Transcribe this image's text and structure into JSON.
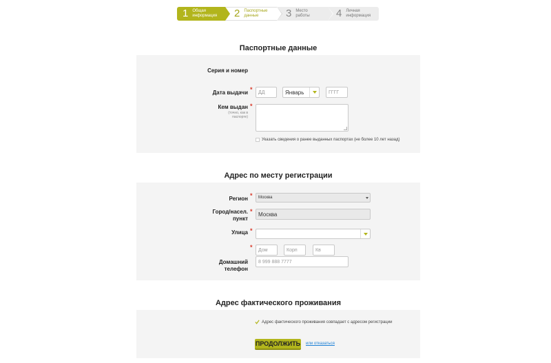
{
  "stepper": {
    "steps": [
      {
        "num": "1",
        "label": "Общая информация"
      },
      {
        "num": "2",
        "label": "Паспортные данные"
      },
      {
        "num": "3",
        "label": "Место работы"
      },
      {
        "num": "4",
        "label": "Личная информация"
      }
    ]
  },
  "passport": {
    "title": "Паспортные данные",
    "series_label": "Серия и номер",
    "issue_date_label": "Дата выдачи",
    "day_placeholder": "ДД",
    "month_value": "Январь",
    "year_placeholder": "ГГГГ",
    "issued_by_label": "Кем выдан",
    "issued_by_hint": "(точно, как в паспорте)",
    "prev_passports_checkbox": "Указать сведения о ранее выданных паспортах (не более 10 лет назад)"
  },
  "registration": {
    "title": "Адрес по месту регистрации",
    "region_label": "Регион",
    "region_value": "Москва",
    "city_label": "Город/насел. пункт",
    "city_value": "Москва",
    "street_label": "Улица",
    "house_placeholder": "Дом",
    "building_placeholder": "Корп",
    "apartment_placeholder": "Кв",
    "phone_label": "Домашний телефон",
    "phone_placeholder": "8 999 888 7777"
  },
  "actual": {
    "title": "Адрес фактического проживания",
    "same_checkbox": "Адрес фактического проживания совпадает с адресом регистрации",
    "same_checked": true
  },
  "actions": {
    "continue_label": "ПРОДОЛЖИТЬ",
    "decline_label": "или отказаться"
  },
  "required_mark": "*",
  "colors": {
    "accent": "#b2b51c",
    "required": "#d83a2a",
    "link": "#1a7fd6",
    "panel_bg": "#f4f4f4"
  }
}
